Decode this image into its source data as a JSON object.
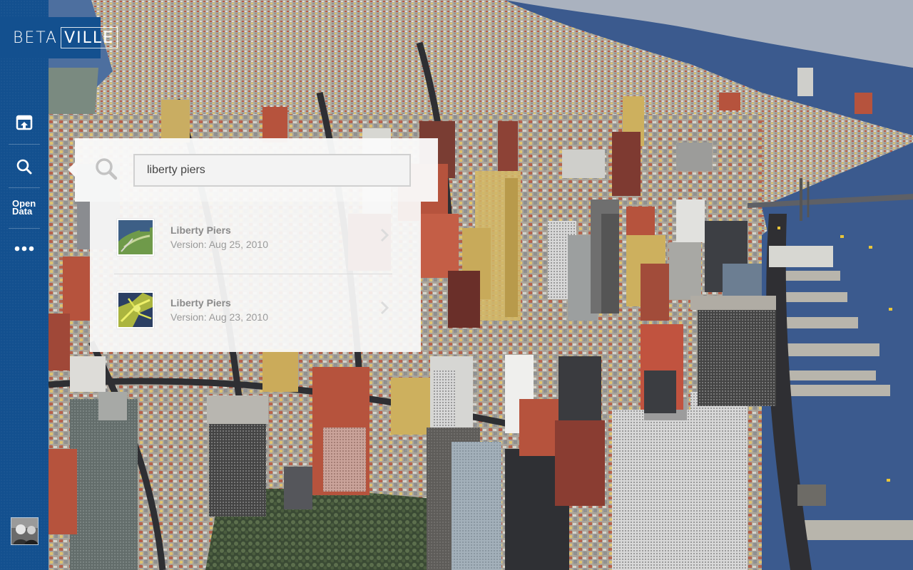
{
  "app": {
    "logo_left": "BETA",
    "logo_right": "VILLE"
  },
  "sidebar": {
    "items": [
      {
        "name": "upload-icon"
      },
      {
        "name": "search-icon"
      },
      {
        "label_line1": "Open",
        "label_line2": "Data"
      },
      {
        "name": "more-icon"
      }
    ]
  },
  "search": {
    "value": "liberty piers"
  },
  "results": [
    {
      "title": "Liberty Piers",
      "version": "Version: Aug 25, 2010"
    },
    {
      "title": "Liberty Piers",
      "version": "Version: Aug 23, 2010"
    }
  ],
  "colors": {
    "sidebar": "#13508f",
    "panel": "#fafafa",
    "water": "#3a5a8c"
  }
}
